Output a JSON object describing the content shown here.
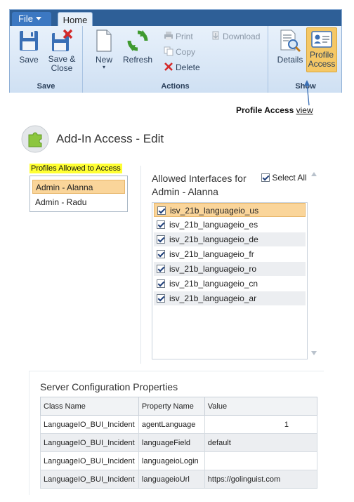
{
  "ribbon": {
    "file_tab": "File",
    "home_tab": "Home",
    "groups": {
      "save": {
        "label": "Save",
        "save": "Save",
        "save_close_line1": "Save &",
        "save_close_line2": "Close"
      },
      "actions": {
        "label": "Actions",
        "new": "New",
        "refresh": "Refresh",
        "print": "Print",
        "copy": "Copy",
        "delete": "Delete",
        "download": "Download"
      },
      "show": {
        "label": "Show",
        "details": "Details",
        "profile_access_line1": "Profile",
        "profile_access_line2": "Access"
      }
    }
  },
  "callout": {
    "bold": "Profile Access",
    "view": "view"
  },
  "editor": {
    "title": "Add-In Access - Edit"
  },
  "profiles": {
    "label": "Profiles Allowed to Access",
    "items": [
      "Admin - Alanna",
      "Admin - Radu"
    ],
    "selected_index": 0
  },
  "interfaces": {
    "title": "Allowed Interfaces for Admin - Alanna",
    "select_all": "Select All",
    "items": [
      "isv_21b_languageio_us",
      "isv_21b_languageio_es",
      "isv_21b_languageio_de",
      "isv_21b_languageio_fr",
      "isv_21b_languageio_ro",
      "isv_21b_languageio_cn",
      "isv_21b_languageio_ar"
    ]
  },
  "server_config": {
    "title": "Server Configuration Properties",
    "columns": [
      "Class Name",
      "Property Name",
      "Value"
    ],
    "rows": [
      [
        "LanguageIO_BUI_Incident",
        "agentLanguage",
        "1"
      ],
      [
        "LanguageIO_BUI_Incident",
        "languageField",
        "default"
      ],
      [
        "LanguageIO_BUI_Incident",
        "languageioLogin",
        ""
      ],
      [
        "LanguageIO_BUI_Incident",
        "languageioUrl",
        "https://golinguist.com"
      ]
    ]
  },
  "colors": {
    "ribbon_tab_bar": "#2e5f97",
    "file_tab": "#3c78c2",
    "selection": "#fad59a",
    "highlight_label": "#ffff33"
  }
}
